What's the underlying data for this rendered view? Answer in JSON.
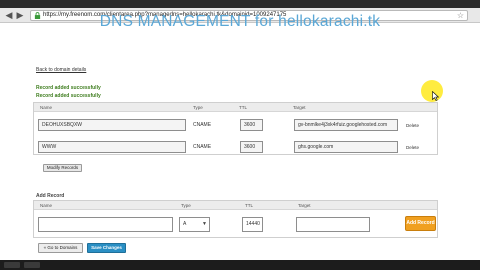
{
  "browser": {
    "url": "https://my.freenom.com/clientarea.php?managedns=hellokarachi.tk&domainid=1009247175"
  },
  "page": {
    "title": "DNS MANAGEMENT for hellokarachi.tk",
    "back_link": "Back to domain details",
    "messages": [
      "Record added successfully",
      "Record added successfully"
    ]
  },
  "records_table": {
    "headers": {
      "name": "Name",
      "type": "Type",
      "ttl": "TTL",
      "target": "Target"
    },
    "rows": [
      {
        "name": "DEOHUXSBQXW",
        "type": "CNAME",
        "ttl": "3600",
        "target": "gv-bnmlke4j3xk4rfuiz.googlehosted.com",
        "action": "Delete"
      },
      {
        "name": "WWW",
        "type": "CNAME",
        "ttl": "3600",
        "target": "ghs.google.com",
        "action": "Delete"
      }
    ],
    "modify_button": "Modify Records"
  },
  "add_record": {
    "label": "Add Record",
    "headers": {
      "name": "Name",
      "type": "Type",
      "ttl": "TTL",
      "target": "Target"
    },
    "name_value": "",
    "type_value": "A",
    "ttl_value": "14440",
    "target_value": "",
    "add_button": "Add Record"
  },
  "footer_buttons": {
    "back": "« Go to Domains",
    "save": "Save Changes"
  },
  "colors": {
    "title": "#5aa7d6",
    "success": "#3e7d1e",
    "add_button": "#f0a020",
    "save_button": "#2a8fc4",
    "cursor_highlight": "#ffe600"
  }
}
